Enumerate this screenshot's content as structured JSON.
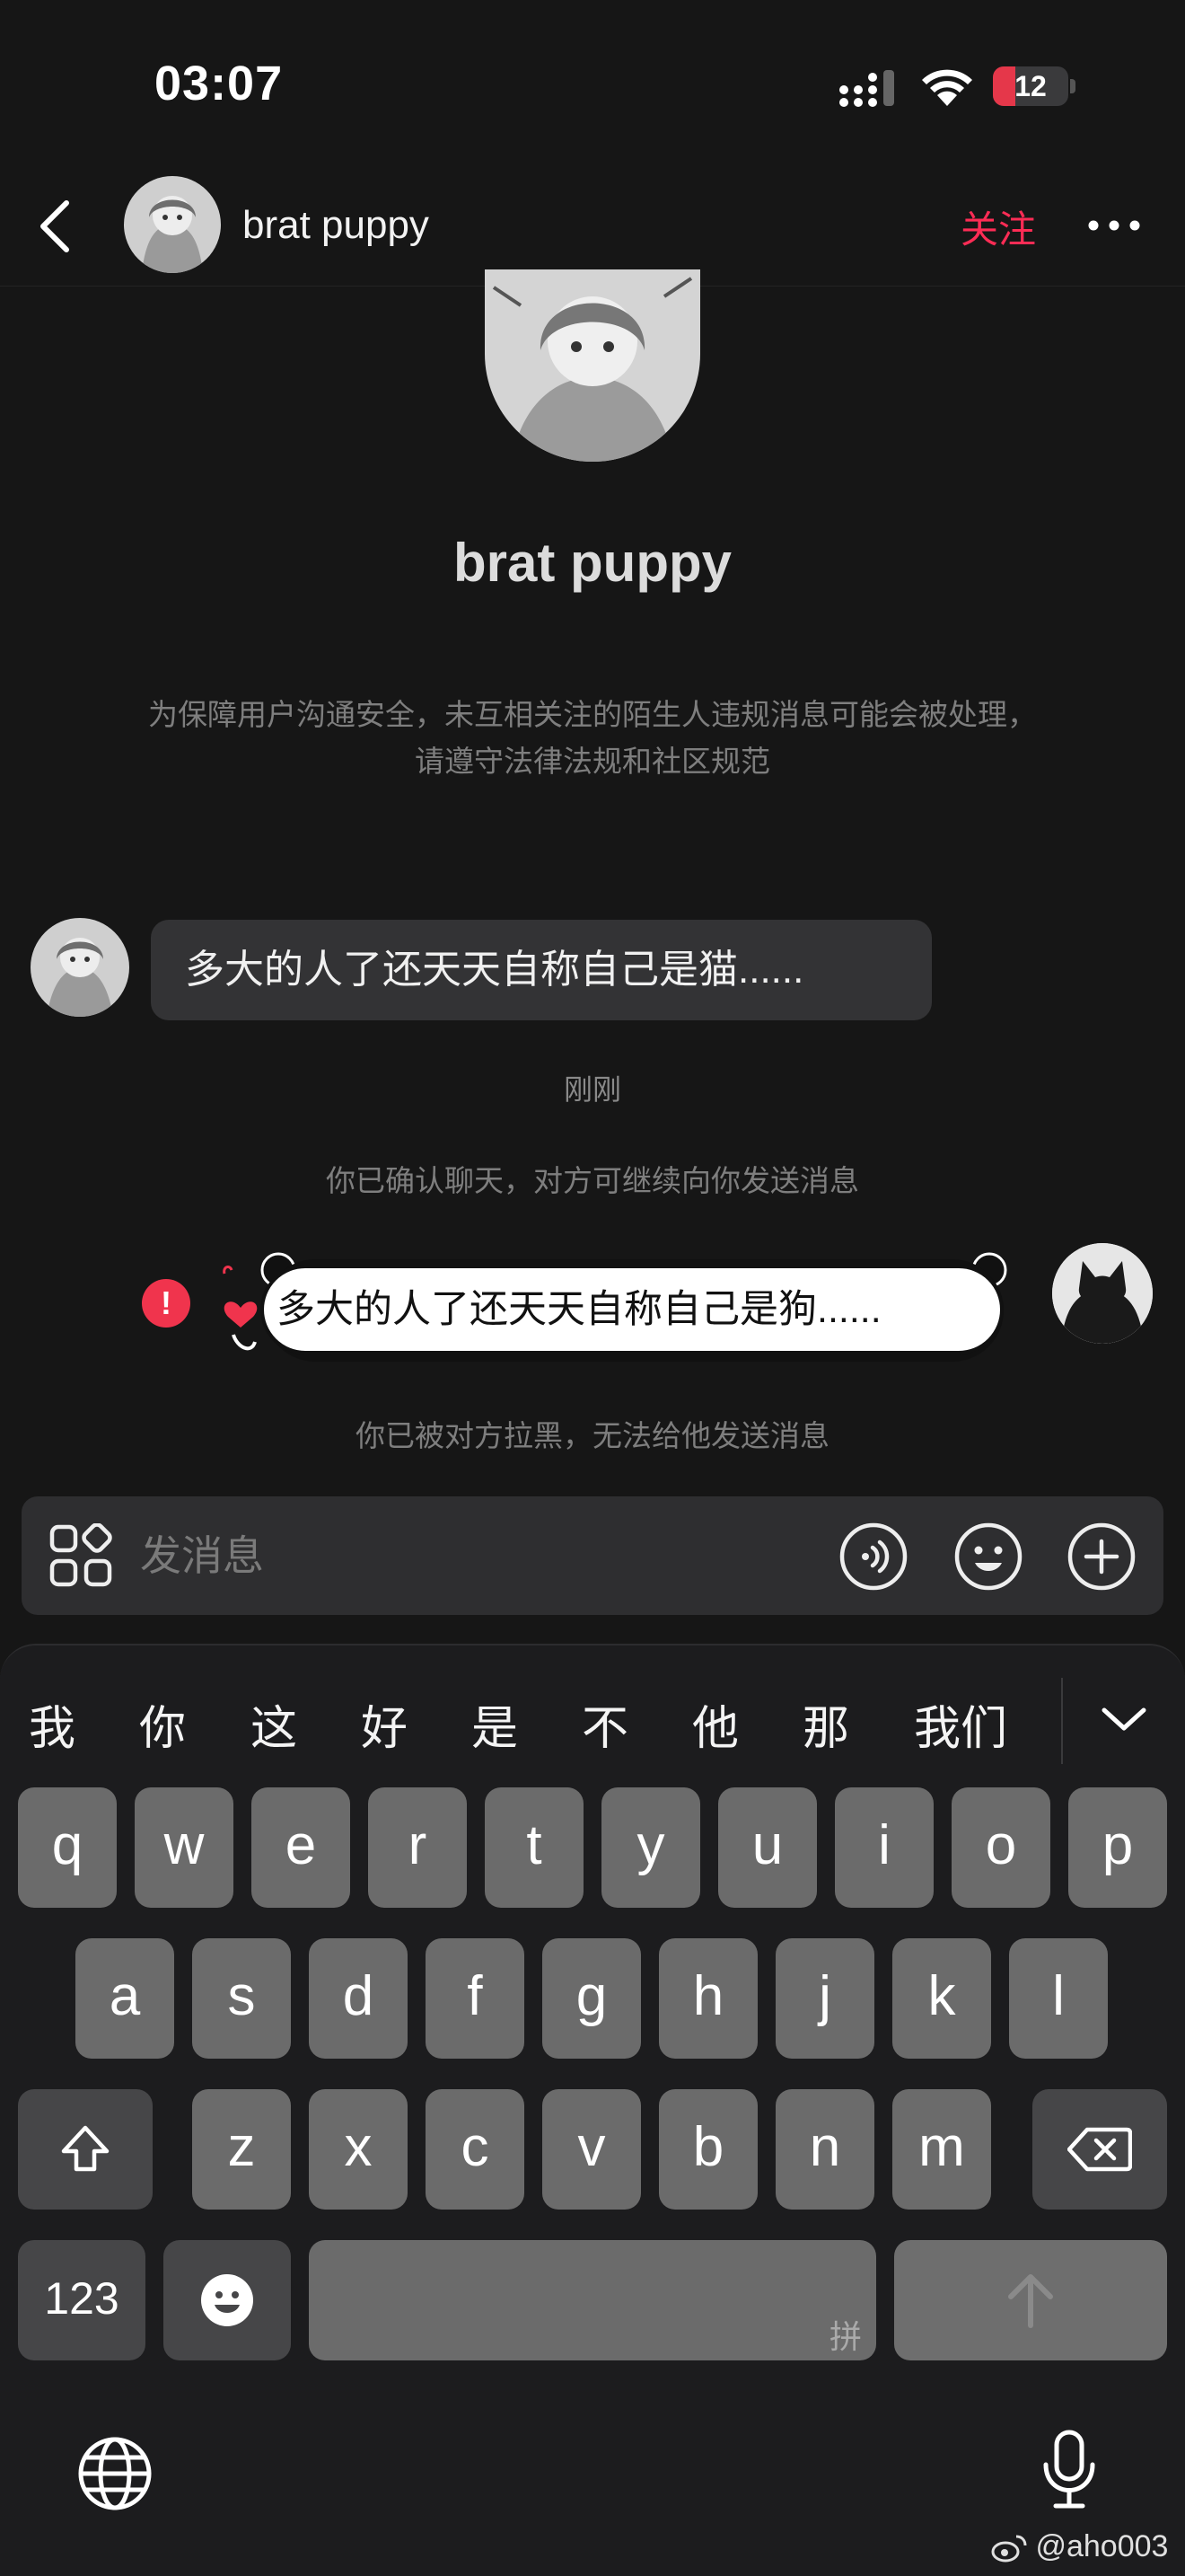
{
  "status_bar": {
    "time": "03:07",
    "battery": "12"
  },
  "header": {
    "name": "brat puppy",
    "follow_label": "关注"
  },
  "profile": {
    "name": "brat puppy",
    "notice": "为保障用户沟通安全，未互相关注的陌生人违规消息可能会被处理，请遵守法律法规和社区规范"
  },
  "messages": {
    "received": "多大的人了还天天自称自己是猫......",
    "timestamp": "刚刚",
    "system_confirm": "你已确认聊天，对方可继续向你发送消息",
    "sent": "多大的人了还天天自称自己是狗......",
    "sent_status_icon": "!",
    "system_blocked": "你已被对方拉黑，无法给他发送消息"
  },
  "input": {
    "placeholder": "发消息"
  },
  "keyboard": {
    "candidates": [
      "我",
      "你",
      "这",
      "好",
      "是",
      "不",
      "他",
      "那",
      "我们"
    ],
    "row1": [
      "q",
      "w",
      "e",
      "r",
      "t",
      "y",
      "u",
      "i",
      "o",
      "p"
    ],
    "row2": [
      "a",
      "s",
      "d",
      "f",
      "g",
      "h",
      "j",
      "k",
      "l"
    ],
    "row3": [
      "z",
      "x",
      "c",
      "v",
      "b",
      "n",
      "m"
    ],
    "numbers_label": "123",
    "space_hint": "拼"
  },
  "watermark": "@aho003",
  "colors": {
    "accent": "#fe2c55",
    "error": "#f0344d",
    "background": "#161616"
  }
}
